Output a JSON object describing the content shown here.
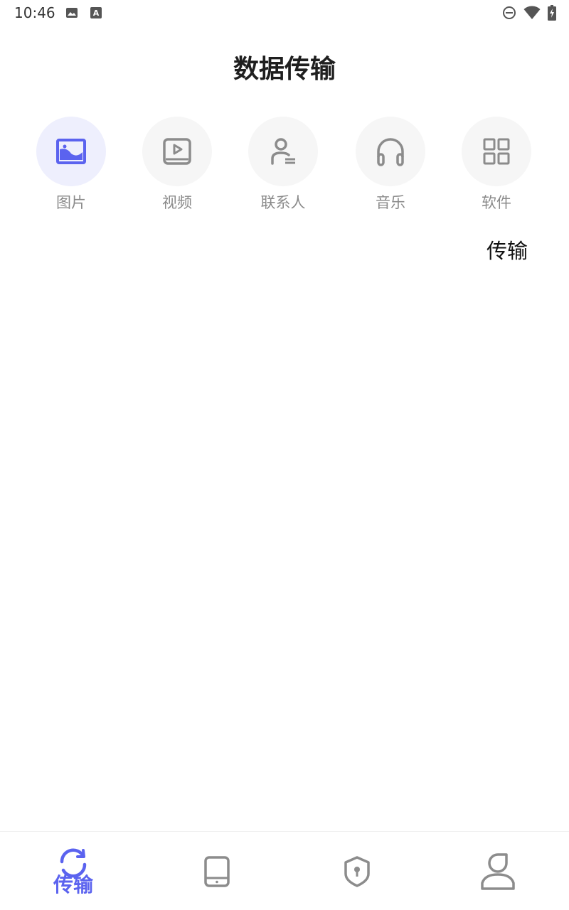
{
  "status_bar": {
    "time": "10:46",
    "icons": [
      "image-icon",
      "text-a-icon",
      "do-not-disturb-icon",
      "wifi-icon",
      "battery-charging-icon"
    ]
  },
  "header": {
    "title": "数据传输"
  },
  "categories": [
    {
      "label": "图片",
      "icon": "image-icon",
      "active": true
    },
    {
      "label": "视频",
      "icon": "video-icon",
      "active": false
    },
    {
      "label": "联系人",
      "icon": "contact-icon",
      "active": false
    },
    {
      "label": "音乐",
      "icon": "headphones-icon",
      "active": false
    },
    {
      "label": "软件",
      "icon": "apps-grid-icon",
      "active": false
    }
  ],
  "transfer_action": {
    "label": "传输"
  },
  "bottom_nav": {
    "items": [
      {
        "label": "传输",
        "icon": "refresh-icon",
        "active": true
      },
      {
        "icon": "device-icon",
        "active": false
      },
      {
        "icon": "shield-lock-icon",
        "active": false
      },
      {
        "icon": "user-icon",
        "active": false
      }
    ]
  },
  "colors": {
    "accent": "#5b63ef",
    "icon_gray": "#8c8c8c",
    "active_circle": "#eeeffd",
    "inactive_circle": "#f6f6f6"
  }
}
